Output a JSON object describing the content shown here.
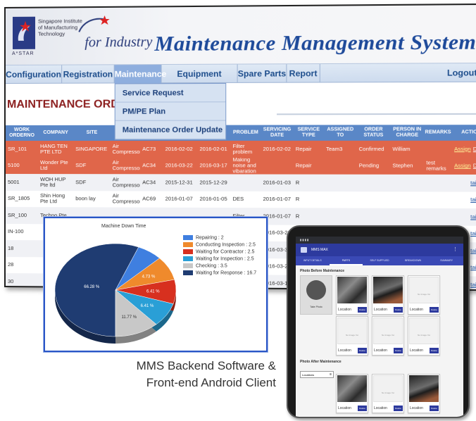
{
  "header": {
    "institute": "Singapore Institute of Manufacturing Technology",
    "astar": "A*STAR",
    "for_industry": "for Industry",
    "title": "Maintenance Management System"
  },
  "nav": {
    "items": [
      "Configuration",
      "Registration",
      "Maintenance",
      "Equipment Summary",
      "Spare Parts",
      "Report"
    ],
    "active_index": 2,
    "logout": "Logout"
  },
  "dropdown": {
    "items": [
      "Service Request",
      "PM/PE Plan",
      "Maintenance Order Update"
    ]
  },
  "page_title": "MAINTENANCE ORDER DE",
  "table": {
    "columns": [
      "WORK ORDERNO",
      "COMPANY",
      "SITE",
      "",
      "",
      "",
      "NT TE",
      "PROBLEM",
      "SERVICING DATE",
      "SERVICE TYPE",
      "ASSIGNED TO",
      "ORDER STATUS",
      "PERSON IN CHARGE",
      "REMARKS",
      "ACTION"
    ],
    "rows": [
      {
        "style": "red",
        "cells": [
          "SR_101",
          "HANG TEN PTE LTD",
          "SINGAPORE",
          "Air Compressor",
          "AC73",
          "2016-02-02",
          "2016-02-01",
          "Filter problem",
          "2016-02-02",
          "Repair",
          "Team3",
          "Confirmed",
          "William",
          "",
          ""
        ]
      },
      {
        "style": "red",
        "cells": [
          "5100",
          "Wonder Pte Ltd",
          "SDF",
          "Air Compressor",
          "AC34",
          "2016-03-22",
          "2016-03-17",
          "Making noise and vibaration",
          "",
          "Repair",
          "",
          "Pending",
          "Stephen",
          "test remarks",
          ""
        ]
      },
      {
        "style": "grey",
        "cells": [
          "5001",
          "WOH HUP Pte ltd",
          "SDF",
          "Air Compressor",
          "AC34",
          "2015-12-31",
          "2015-12-29",
          "",
          "2016-01-03",
          "R",
          "",
          "",
          "",
          "",
          ""
        ]
      },
      {
        "style": "white",
        "cells": [
          "SR_1805",
          "Shin Hong Pte Ltd",
          "boon lay",
          "Air Compressor",
          "AC69",
          "2016-01-07",
          "2016-01-05",
          "DES",
          "2016-01-07",
          "R",
          "",
          "",
          "",
          "",
          ""
        ]
      },
      {
        "style": "grey",
        "cells": [
          "SR_100",
          "Techno Pte",
          "",
          "",
          "",
          "",
          "",
          "Filter",
          "2016-01-07",
          "R",
          "",
          "",
          "",
          "",
          ""
        ]
      },
      {
        "style": "white",
        "cells": [
          "IN-100",
          "",
          "",
          "",
          "",
          "",
          "",
          "",
          "2016-03-23",
          "In Se",
          "",
          "",
          "",
          "",
          ""
        ]
      },
      {
        "style": "grey",
        "cells": [
          "18",
          "",
          "",
          "",
          "",
          "",
          "",
          "",
          "2016-03-31",
          "Pl",
          "",
          "",
          "",
          "",
          ""
        ]
      },
      {
        "style": "white",
        "cells": [
          "28",
          "",
          "",
          "",
          "",
          "",
          "",
          "",
          "2016-03-26",
          "Pl",
          "",
          "",
          "",
          "",
          ""
        ]
      },
      {
        "style": "grey",
        "cells": [
          "30",
          "",
          "",
          "",
          "",
          "",
          "",
          "",
          "2016-03-11",
          "Pl",
          "",
          "",
          "",
          "",
          ""
        ]
      },
      {
        "style": "white",
        "cells": [
          "32",
          "",
          "",
          "",
          "",
          "",
          "",
          "",
          "2016-03-23",
          "Pl",
          "",
          "",
          "",
          "",
          ""
        ]
      }
    ],
    "action_assign": "Assign",
    "action_details": "Details",
    "action_short": "tails"
  },
  "chart_data": {
    "type": "pie",
    "title": "Machine Down Time",
    "categories": [
      "Repairing",
      "Conducting Inspection",
      "Waiting for Contractor",
      "Waiting for Inspection",
      "Checking",
      "Waiting for Response"
    ],
    "values": [
      2,
      2.5,
      2.5,
      2.5,
      3.5,
      16.7
    ],
    "colors": [
      "#3f7fe0",
      "#ef8a2c",
      "#d7301f",
      "#2a9fd6",
      "#c8c8c8",
      "#1f3c72"
    ],
    "slice_labels": [
      "",
      "4.73 %",
      "6.41 %",
      "6.41 %",
      "11.77 %",
      "66.28 %"
    ],
    "legend_position": "right"
  },
  "tablet": {
    "app_name": "MMS MAX",
    "tabs": [
      "INPUT DETAILS",
      "PARTS",
      "SELF SUPPLIED",
      "BREAKDOWN",
      "SUMMARY"
    ],
    "active_tab": 1,
    "section_before": "Photo Before Maintenance",
    "section_after": "Photo After Maintenance",
    "take_photo": "Take Photo",
    "location": "Location",
    "delete": "Delete",
    "no_image": "No Image Yet",
    "locations_select": "Locations"
  },
  "caption": {
    "line1": "MMS Backend Software &",
    "line2": "Front-end Android Client"
  }
}
